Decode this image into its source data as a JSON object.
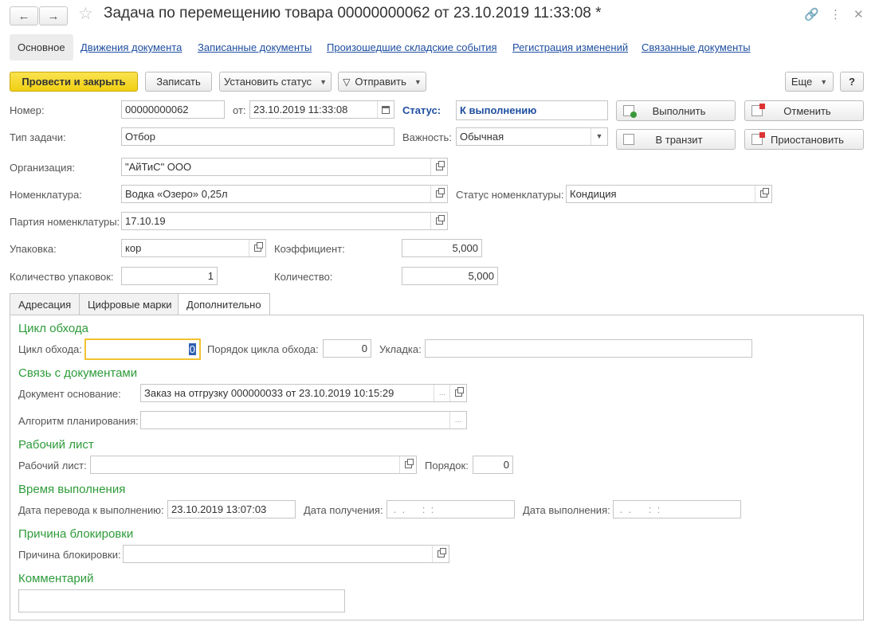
{
  "window": {
    "title": "Задача по перемещению товара 00000000062 от 23.10.2019 11:33:08 *"
  },
  "form_tabs": [
    {
      "label": "Основное"
    },
    {
      "label": "Движения документа"
    },
    {
      "label": "Записанные документы"
    },
    {
      "label": "Произошедшие складские события"
    },
    {
      "label": "Регистрация изменений"
    },
    {
      "label": "Связанные документы"
    }
  ],
  "toolbar": {
    "post_close": "Провести и закрыть",
    "save": "Записать",
    "set_status": "Установить статус",
    "send": "Отправить",
    "more": "Еще",
    "help": "?"
  },
  "header": {
    "number_label": "Номер:",
    "number_value": "00000000062",
    "date_label": "от:",
    "date_value": "23.10.2019 11:33:08",
    "status_label": "Статус:",
    "status_value": "К выполнению",
    "task_type_label": "Тип задачи:",
    "task_type_value": "Отбор",
    "importance_label": "Важность:",
    "importance_value": "Обычная",
    "org_label": "Организация:",
    "org_value": "\"АйТиС\" ООО",
    "nom_label": "Номенклатура:",
    "nom_value": "Водка «Озеро» 0,25л",
    "nom_status_label": "Статус номенклатуры:",
    "nom_status_value": "Кондиция",
    "batch_label": "Партия номенклатуры:",
    "batch_value": "17.10.19",
    "pack_label": "Упаковка:",
    "pack_value": "кор",
    "coef_label": "Коэффициент:",
    "coef_value": "5,000",
    "pack_qty_label": "Количество упаковок:",
    "pack_qty_value": "1",
    "qty_label": "Количество:",
    "qty_value": "5,000"
  },
  "actions": {
    "execute": "Выполнить",
    "cancel": "Отменить",
    "transit": "В транзит",
    "suspend": "Приостановить"
  },
  "sub_tabs": [
    {
      "label": "Адресация"
    },
    {
      "label": "Цифровые марки"
    },
    {
      "label": "Дополнительно"
    }
  ],
  "additional": {
    "cycle_section": "Цикл обхода",
    "cycle_label": "Цикл обхода:",
    "cycle_value": "0",
    "cycle_order_label": "Порядок цикла обхода:",
    "cycle_order_value": "0",
    "packing_label": "Укладка:",
    "packing_value": "",
    "docs_section": "Связь с документами",
    "base_doc_label": "Документ основание:",
    "base_doc_value": "Заказ на отгрузку 000000033 от 23.10.2019 10:15:29",
    "algo_label": "Алгоритм планирования:",
    "algo_value": "",
    "worksheet_section": "Рабочий лист",
    "worksheet_label": "Рабочий лист:",
    "worksheet_value": "",
    "order_label": "Порядок:",
    "order_value": "0",
    "time_section": "Время выполнения",
    "transfer_date_label": "Дата перевода к выполнению:",
    "transfer_date_value": "23.10.2019 13:07:03",
    "receive_date_label": "Дата получения:",
    "receive_date_value": " .  .      :  :",
    "done_date_label": "Дата выполнения:",
    "done_date_value": " .  .      :  :",
    "block_section": "Причина блокировки",
    "block_label": "Причина блокировки:",
    "block_value": "",
    "comment_section": "Комментарий",
    "comment_value": ""
  },
  "colors": {
    "link": "#1f4fa0",
    "section": "#2e9b3a",
    "primary_button": "#f1cf13",
    "focus": "#f2c230"
  }
}
